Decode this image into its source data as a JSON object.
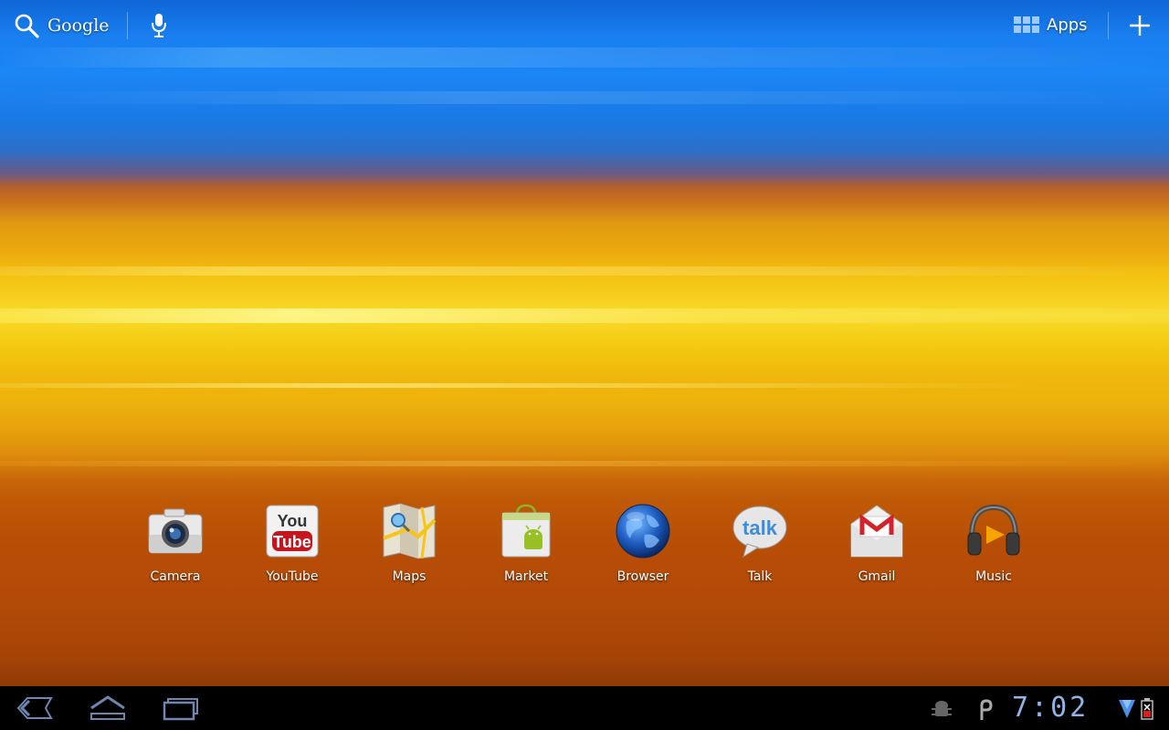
{
  "top_bar": {
    "search_label": "Google",
    "apps_label": "Apps"
  },
  "dock": {
    "apps": [
      {
        "label": "Camera"
      },
      {
        "label": "YouTube"
      },
      {
        "label": "Maps"
      },
      {
        "label": "Market"
      },
      {
        "label": "Browser"
      },
      {
        "label": "Talk"
      },
      {
        "label": "Gmail"
      },
      {
        "label": "Music"
      }
    ]
  },
  "icons": {
    "youtube_top": "You",
    "youtube_bottom": "Tube",
    "talk": "talk"
  },
  "system_bar": {
    "clock": "7:02"
  },
  "colors": {
    "sky_blue": "#1b86f5",
    "sunset_yellow": "#f8dc2c",
    "sunset_orange": "#b84d06",
    "system_bar": "#000000",
    "clock_blue": "#8fb4e8"
  }
}
